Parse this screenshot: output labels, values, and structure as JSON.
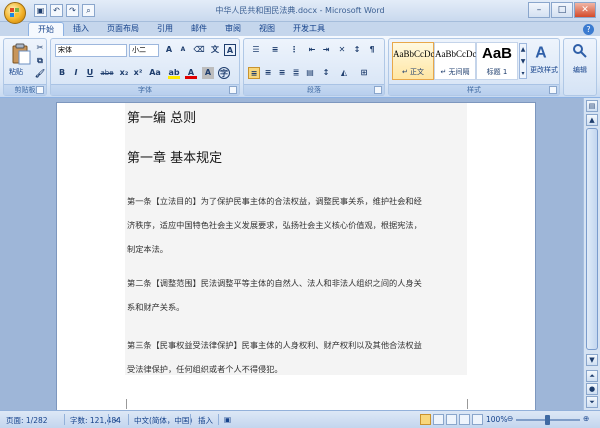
{
  "window": {
    "title": "中华人民共和国民法典.docx - Microsoft Word",
    "qat": [
      "save",
      "undo",
      "redo",
      "print-preview"
    ],
    "controls": [
      "minimize",
      "maximize",
      "close"
    ]
  },
  "tabs": [
    {
      "label": "开始",
      "active": true
    },
    {
      "label": "插入",
      "active": false
    },
    {
      "label": "页面布局",
      "active": false
    },
    {
      "label": "引用",
      "active": false
    },
    {
      "label": "邮件",
      "active": false
    },
    {
      "label": "审阅",
      "active": false
    },
    {
      "label": "视图",
      "active": false
    },
    {
      "label": "开发工具",
      "active": false
    }
  ],
  "ribbon": {
    "clipboard": {
      "label": "剪贴板",
      "paste": "粘贴"
    },
    "font": {
      "label": "字体",
      "name": "宋体",
      "size": "小二",
      "buttons": [
        "B",
        "I",
        "U",
        "abe",
        "x₂",
        "x²",
        "Aa",
        "A"
      ]
    },
    "paragraph": {
      "label": "段落"
    },
    "styles": {
      "label": "样式",
      "items": [
        {
          "sample": "AaBbCcDc",
          "name": "↵ 正文",
          "selected": true
        },
        {
          "sample": "AaBbCcDc",
          "name": "↵ 无间隔",
          "selected": false
        },
        {
          "sample": "AaB",
          "name": "标题 1",
          "selected": false
        }
      ],
      "change": "更改样式"
    },
    "editing": {
      "label": "编辑"
    }
  },
  "document": {
    "part": "第一编 总则",
    "chapter": "第一章 基本规定",
    "lines": [
      "第一条【立法目的】为了保护民事主体的合法权益，调整民事关系，维护社会和经",
      "济秩序，适应中国特色社会主义发展要求，弘扬社会主义核心价值观，根据宪法，",
      "制定本法。",
      "第二条【调整范围】民法调整平等主体的自然人、法人和非法人组织之间的人身关",
      "系和财产关系。",
      "第三条【民事权益受法律保护】民事主体的人身权利、财产权利以及其他合法权益",
      "受法律保护，任何组织或者个人不得侵犯。"
    ]
  },
  "status": {
    "page": "页面: 1/282",
    "words": "字数: 121,484",
    "language": "中文(简体，中国)",
    "mode": "插入",
    "zoom": "100%"
  },
  "colors": {
    "accent": "#15428b",
    "ribbon": "#dbe7f6",
    "workspace": "#9eb6d8"
  }
}
